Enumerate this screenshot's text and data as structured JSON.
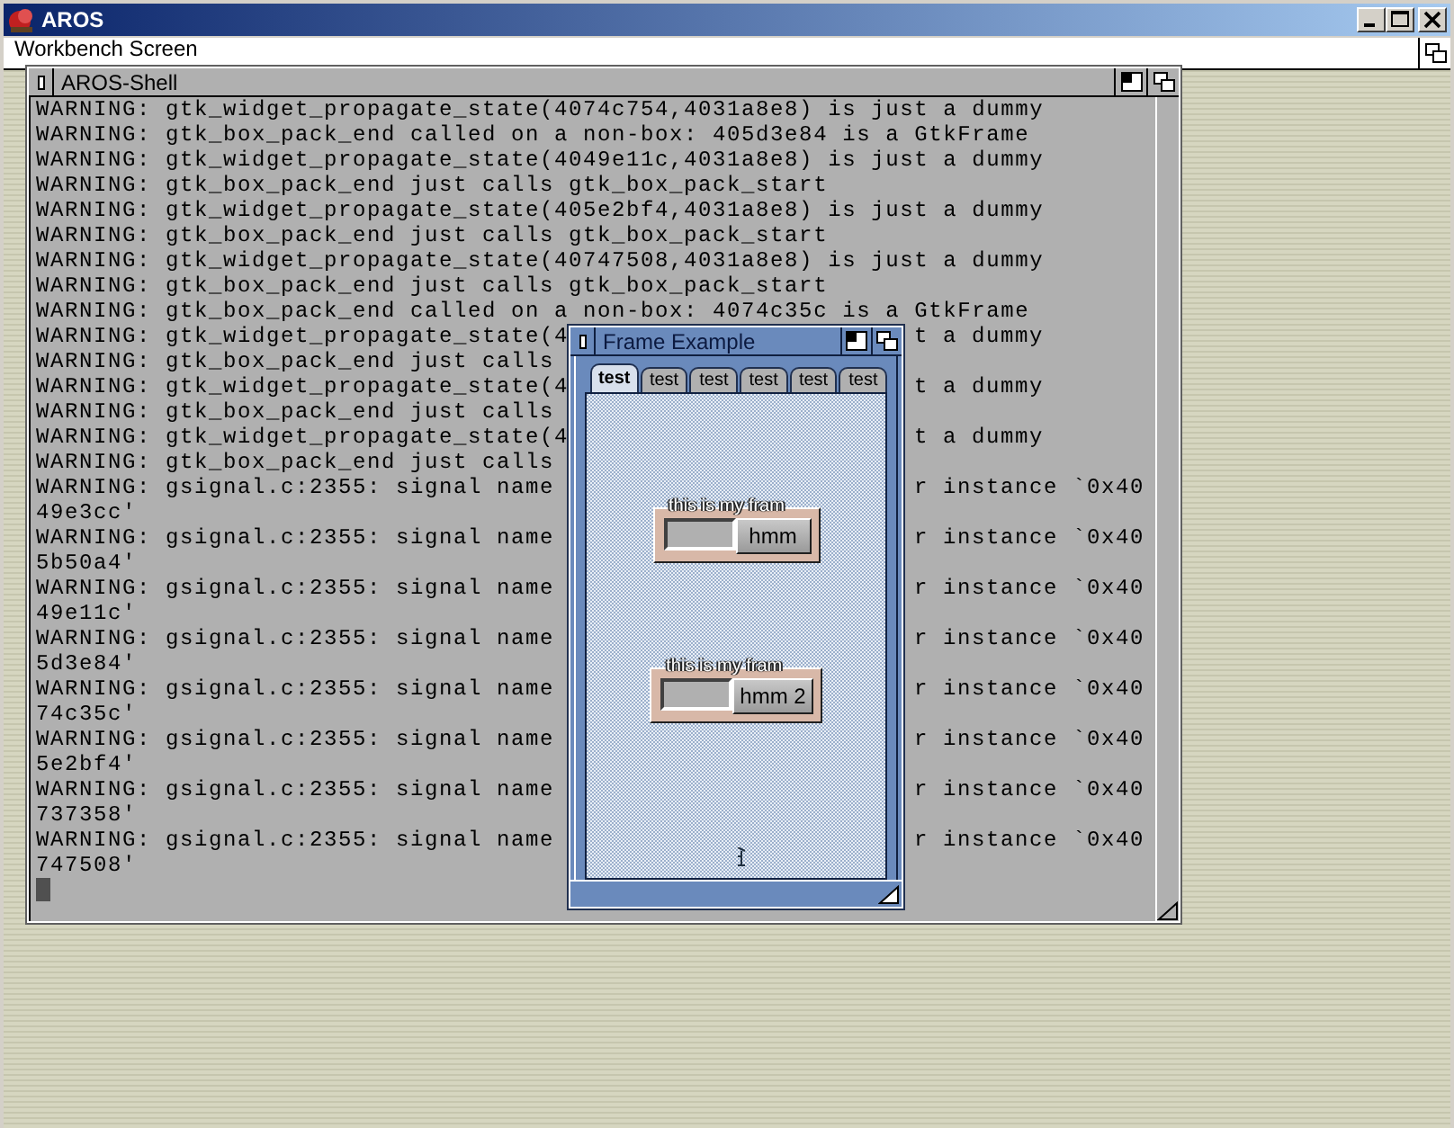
{
  "window": {
    "title": "AROS"
  },
  "screen": {
    "title": "Workbench Screen"
  },
  "shell": {
    "title": "AROS-Shell",
    "lines": [
      {
        "text": "WARNING: gtk_widget_propagate_state(4074c754,4031a8e8) is just a dummy"
      },
      {
        "text": "WARNING: gtk_box_pack_end called on a non-box: 405d3e84 is a GtkFrame"
      },
      {
        "text": "WARNING: gtk_widget_propagate_state(4049e11c,4031a8e8) is just a dummy"
      },
      {
        "text": "WARNING: gtk_box_pack_end just calls gtk_box_pack_start"
      },
      {
        "text": "WARNING: gtk_widget_propagate_state(405e2bf4,4031a8e8) is just a dummy"
      },
      {
        "text": "WARNING: gtk_box_pack_end just calls gtk_box_pack_start"
      },
      {
        "text": "WARNING: gtk_widget_propagate_state(40747508,4031a8e8) is just a dummy"
      },
      {
        "text": "WARNING: gtk_box_pack_end just calls gtk_box_pack_start"
      },
      {
        "text": "WARNING: gtk_box_pack_end called on a non-box: 4074c35c is a GtkFrame"
      },
      {
        "text": "WARNING: gtk_widget_propagate_state(4",
        "right": "t a dummy"
      },
      {
        "text": "WARNING: gtk_box_pack_end just calls"
      },
      {
        "text": "WARNING: gtk_widget_propagate_state(4",
        "right": "t a dummy"
      },
      {
        "text": "WARNING: gtk_box_pack_end just calls"
      },
      {
        "text": "WARNING: gtk_widget_propagate_state(4",
        "right": "t a dummy"
      },
      {
        "text": "WARNING: gtk_box_pack_end just calls"
      },
      {
        "text": "WARNING: gsignal.c:2355: signal name",
        "right": "r instance `0x40"
      },
      {
        "text": "49e3cc'"
      },
      {
        "text": "WARNING: gsignal.c:2355: signal name",
        "right": "r instance `0x40"
      },
      {
        "text": "5b50a4'"
      },
      {
        "text": "WARNING: gsignal.c:2355: signal name",
        "right": "r instance `0x40"
      },
      {
        "text": "49e11c'"
      },
      {
        "text": "WARNING: gsignal.c:2355: signal name",
        "right": "r instance `0x40"
      },
      {
        "text": "5d3e84'"
      },
      {
        "text": "WARNING: gsignal.c:2355: signal name",
        "right": "r instance `0x40"
      },
      {
        "text": "74c35c'"
      },
      {
        "text": "WARNING: gsignal.c:2355: signal name",
        "right": "r instance `0x40"
      },
      {
        "text": "5e2bf4'"
      },
      {
        "text": "WARNING: gsignal.c:2355: signal name",
        "right": "r instance `0x40"
      },
      {
        "text": "737358'"
      },
      {
        "text": "WARNING: gsignal.c:2355: signal name",
        "right": "r instance `0x40"
      },
      {
        "text": "747508'"
      }
    ]
  },
  "frame_window": {
    "title": "Frame Example",
    "tabs": [
      {
        "label": "test",
        "selected": true
      },
      {
        "label": "test",
        "selected": false
      },
      {
        "label": "test",
        "selected": false
      },
      {
        "label": "test",
        "selected": false
      },
      {
        "label": "test",
        "selected": false
      },
      {
        "label": "test",
        "selected": false
      }
    ],
    "frames": [
      {
        "legend": "this is my fram",
        "button": "hmm"
      },
      {
        "legend": "this is my fram",
        "button": "hmm 2"
      }
    ]
  }
}
